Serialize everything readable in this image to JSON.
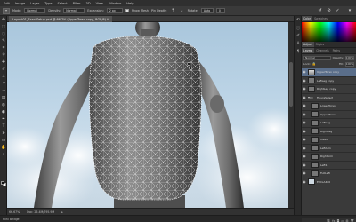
{
  "menu": [
    "Edit",
    "Image",
    "Layer",
    "Type",
    "Select",
    "Filter",
    "3D",
    "View",
    "Window",
    "Help"
  ],
  "options": {
    "mode_label": "Mode:",
    "mode_value": "Normal",
    "density_label": "Density:",
    "density_value": "Normal",
    "expansion_label": "Expansion:",
    "expansion_value": "2 px",
    "show_mesh_label": "Show Mesh",
    "pin_depth_label": "Pin Depth:",
    "rotate_label": "Rotate:",
    "rotate_value": "Auto",
    "angle_value": "0"
  },
  "document": {
    "tab_title": "Layout01_ExactSetup.psd @ 66.7% (UpperTorso copy, RGB/8) *",
    "status_zoom": "66.67%",
    "status_doc": "Doc: 26.4M/795.9M",
    "bottom_label": "Mini Bridge"
  },
  "panels": {
    "top_tabs": [
      "Color",
      "Swatches"
    ],
    "mid_tabs": [
      "Adjust",
      "Styles"
    ],
    "layer_tabs": [
      "Layers",
      "Channels",
      "Paths"
    ],
    "blend_mode": "Normal",
    "opacity_label": "Opacity:",
    "opacity_value": "100%",
    "lock_label": "Lock:",
    "fill_label": "Fill:",
    "fill_value": "100%",
    "layers": [
      {
        "name": "UpperTorso copy",
        "type": "layer",
        "selected": true,
        "indent": false
      },
      {
        "name": "LeftLeg copy",
        "type": "layer",
        "selected": false,
        "indent": false
      },
      {
        "name": "RightLeg copy",
        "type": "layer",
        "selected": false,
        "indent": false
      },
      {
        "name": "FigureSelect",
        "type": "group",
        "selected": false,
        "indent": false
      },
      {
        "name": "LowerTorso",
        "type": "layer",
        "selected": false,
        "indent": true
      },
      {
        "name": "UpperTorso",
        "type": "layer",
        "selected": false,
        "indent": true
      },
      {
        "name": "LeftLeg",
        "type": "layer",
        "selected": false,
        "indent": true
      },
      {
        "name": "RightLeg",
        "type": "layer",
        "selected": false,
        "indent": true
      },
      {
        "name": "Head",
        "type": "layer",
        "selected": false,
        "indent": true
      },
      {
        "name": "LeftArm",
        "type": "layer",
        "selected": false,
        "indent": true
      },
      {
        "name": "RightArm",
        "type": "layer",
        "selected": false,
        "indent": true
      },
      {
        "name": "Left1",
        "type": "layer",
        "selected": false,
        "indent": true
      },
      {
        "name": "FullLeft",
        "type": "layer",
        "selected": false,
        "indent": true
      },
      {
        "name": "EYCLA400",
        "type": "layer",
        "selected": false,
        "indent": false
      }
    ]
  }
}
